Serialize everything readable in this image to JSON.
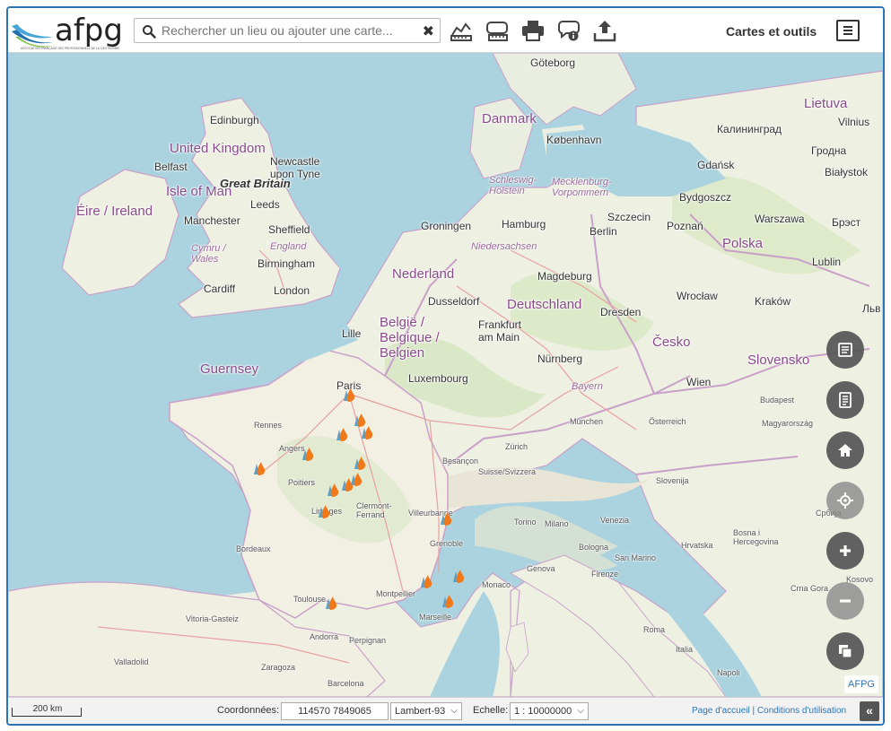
{
  "header": {
    "logo_text": "afpg",
    "logo_subtitle": "ASSOCIATION FRANÇAISE DES PROFESSIONNELS DE LA GÉOTHERMIE",
    "search_placeholder": "Rechercher un lieu ou ajouter une carte...",
    "menu_title": "Cartes et outils"
  },
  "toolbar": {
    "icons": [
      "profile-chart-icon",
      "layers-measure-icon",
      "print-icon",
      "info-bubble-icon",
      "upload-icon"
    ]
  },
  "map": {
    "labels": {
      "goteborg": "Göteborg",
      "danmark": "Danmark",
      "kobenhavn": "København",
      "lietuva": "Lietuva",
      "vilnius": "Vilnius",
      "kaliningrad": "Калининград",
      "grodna": "Гродна",
      "edinburgh": "Edinburgh",
      "united_kingdom": "United Kingdom",
      "belfast": "Belfast",
      "newcastle": "Newcastle upon Tyne",
      "great_britain": "Great Britain",
      "isle_of_man": "Isle of Man",
      "eire": "Éire / Ireland",
      "leeds": "Leeds",
      "manchester": "Manchester",
      "sheffield": "Sheffield",
      "england": "England",
      "cymru": "Cymru / Wales",
      "birmingham": "Birmingham",
      "cardiff": "Cardiff",
      "london": "London",
      "schleswig": "Schleswig-Holstein",
      "mecklenburg": "Mecklenburg-Vorpommern",
      "gdansk": "Gdańsk",
      "bialystok": "Białystok",
      "bydgoszcz": "Bydgoszcz",
      "groningen": "Groningen",
      "hamburg": "Hamburg",
      "szczecin": "Szczecin",
      "warszawa": "Warszawa",
      "brest": "Брэст",
      "berlin": "Berlin",
      "poznan": "Poznań",
      "polska": "Polska",
      "niedersachsen": "Niedersachsen",
      "nederland": "Nederland",
      "magdeburg": "Magdeburg",
      "lublin": "Lublin",
      "dusseldorf": "Dusseldorf",
      "deutschland": "Deutschland",
      "wroclaw": "Wrocław",
      "krakow": "Kraków",
      "lviv": "Льв",
      "lille": "Lille",
      "belgie": "België / Belgique / Belgien",
      "frankfurt": "Frankfurt am Main",
      "dresden": "Dresden",
      "cesko": "Česko",
      "nurnberg": "Nürnberg",
      "guernsey": "Guernsey",
      "luxembourg": "Luxembourg",
      "slovensko": "Slovensko",
      "paris": "Paris",
      "bayern": "Bayern",
      "wien": "Wien",
      "budapest": "Budapest",
      "rennes": "Rennes",
      "munchen": "München",
      "osterreich": "Österreich",
      "magyarorszag": "Magyarország",
      "angers": "Angers",
      "zurich": "Zürich",
      "suisse": "Suisse/Svizzera",
      "besancon": "Besançon",
      "poitiers": "Poitiers",
      "slovenija": "Slovenija",
      "clermont": "Clermont-Ferrand",
      "villeurbanne": "Villeurbanne",
      "torino": "Torino",
      "venezia": "Venezia",
      "milano": "Milano",
      "hrvatska": "Hrvatska",
      "limoges": "Limoges",
      "grenoble": "Grenoble",
      "bordeaux": "Bordeaux",
      "bologna": "Bologna",
      "bosna": "Bosna i Hercegovina",
      "srbija": "Србија",
      "genova": "Genova",
      "monaco": "Monaco",
      "toulouse": "Toulouse",
      "montpellier": "Montpellier",
      "marseille": "Marseille",
      "firenze": "Firenze",
      "san_marino": "San Marino",
      "crna_gora": "Crna Gora",
      "kosovo": "Kosovo",
      "vitoria": "Vitoria-Gasteiz",
      "andorra": "Andorra",
      "perpignan": "Perpignan",
      "italia": "Italia",
      "roma": "Roma",
      "valladolid": "Valladolid",
      "zaragoza": "Zaragoza",
      "barcelona": "Barcelona",
      "napoli": "Napoli"
    },
    "attribution": "AFPG"
  },
  "controls": [
    "legend-icon",
    "catalog-icon",
    "home-icon",
    "geolocate-icon",
    "zoom-in-icon",
    "zoom-out-icon",
    "overview-icon"
  ],
  "footer": {
    "scale_bar": "200 km",
    "coord_label": "Coordonnées:",
    "coord_value": "114570 7849065",
    "projection": "Lambert-93",
    "scale_label": "Echelle:",
    "scale_value": "1 : 10000000",
    "link_home": "Page d'accueil",
    "link_separator": "|",
    "link_terms": "Conditions d'utilisation",
    "collapse": "«"
  },
  "colors": {
    "accent": "#2e74b5",
    "marker": "#f07a1a",
    "marker_blue": "#5aa0c8"
  }
}
